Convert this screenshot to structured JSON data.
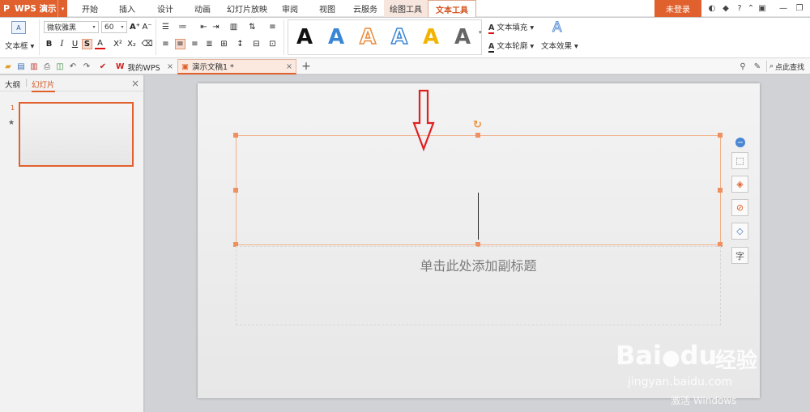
{
  "app": {
    "logo": "P",
    "name": "WPS 演示",
    "dropdown": "▾"
  },
  "menu_tabs": [
    {
      "label": "开始"
    },
    {
      "label": "插入"
    },
    {
      "label": "设计"
    },
    {
      "label": "动画"
    },
    {
      "label": "幻灯片放映"
    },
    {
      "label": "审阅"
    },
    {
      "label": "视图"
    },
    {
      "label": "云服务"
    },
    {
      "label": "绘图工具"
    },
    {
      "label": "文本工具"
    }
  ],
  "account": {
    "login_label": "未登录",
    "help": "?"
  },
  "ribbon": {
    "textbox_label": "文本框",
    "font_name": "微软雅黑",
    "font_size": "60",
    "styles": {
      "bold": "B",
      "italic": "I",
      "underline": "U",
      "shadow": "S",
      "font_color": "A",
      "superscript": "X²",
      "subscript": "X₂"
    },
    "art_letter": "A",
    "art_colors": [
      "#111111",
      "#3a86d6",
      "#e98a3a",
      "#3a86d6",
      "#f2b400",
      "#666666"
    ],
    "text_fill": "文本填充",
    "text_outline": "文本轮廓",
    "text_effect": "文本效果"
  },
  "doc_tabs": {
    "mywps": "我的WPS",
    "current": "演示文稿1 *",
    "close": "×",
    "add": "+"
  },
  "search": {
    "label": "点此查找"
  },
  "panel": {
    "outline_tab": "大纲",
    "slides_tab": "幻灯片",
    "close": "×",
    "slide_number": "1",
    "star": "★"
  },
  "slide": {
    "subtitle_placeholder": "单击此处添加副标题"
  },
  "watermark": {
    "logo": "Bai",
    "logo2": "du",
    "jingyan": "经验",
    "url": "jingyan.baidu.com",
    "activate": "激活 Windows"
  }
}
